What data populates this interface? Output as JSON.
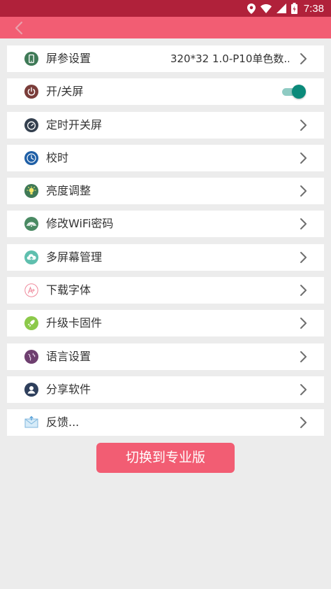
{
  "status_bar": {
    "time": "7:38",
    "icons": [
      "location-icon",
      "wifi-icon",
      "cell-signal-icon",
      "battery-icon"
    ]
  },
  "app_bar": {
    "back_icon": "back-arrow-icon"
  },
  "colors": {
    "status_bar": "#b0213a",
    "app_bar": "#f25d73",
    "accent_button": "#f25d73",
    "toggle_on": "#0b8a7a",
    "background": "#ececec"
  },
  "menu": {
    "items": [
      {
        "label": "屏参设置",
        "value": "320*32 1.0-P10单色数...",
        "icon": "phone-icon",
        "has_chevron": true
      },
      {
        "label": "开/关屏",
        "icon": "power-icon",
        "toggle_on": true
      },
      {
        "label": "定时开关屏",
        "icon": "timer-icon",
        "has_chevron": true
      },
      {
        "label": "校时",
        "icon": "clock-icon",
        "has_chevron": true
      },
      {
        "label": "亮度调整",
        "icon": "brightness-icon",
        "has_chevron": true
      },
      {
        "label": "修改WiFi密码",
        "icon": "wifi-password-icon",
        "has_chevron": true
      },
      {
        "label": "多屏幕管理",
        "icon": "cloud-upload-icon",
        "has_chevron": true
      },
      {
        "label": "下载字体",
        "icon": "font-icon",
        "has_chevron": true
      },
      {
        "label": "升级卡固件",
        "icon": "rocket-icon",
        "has_chevron": true
      },
      {
        "label": "语言设置",
        "icon": "globe-icon",
        "has_chevron": true
      },
      {
        "label": "分享软件",
        "icon": "user-icon",
        "has_chevron": true
      },
      {
        "label": "反馈...",
        "icon": "mail-icon",
        "has_chevron": true
      }
    ]
  },
  "pro_button": {
    "label": "切换到专业版"
  }
}
